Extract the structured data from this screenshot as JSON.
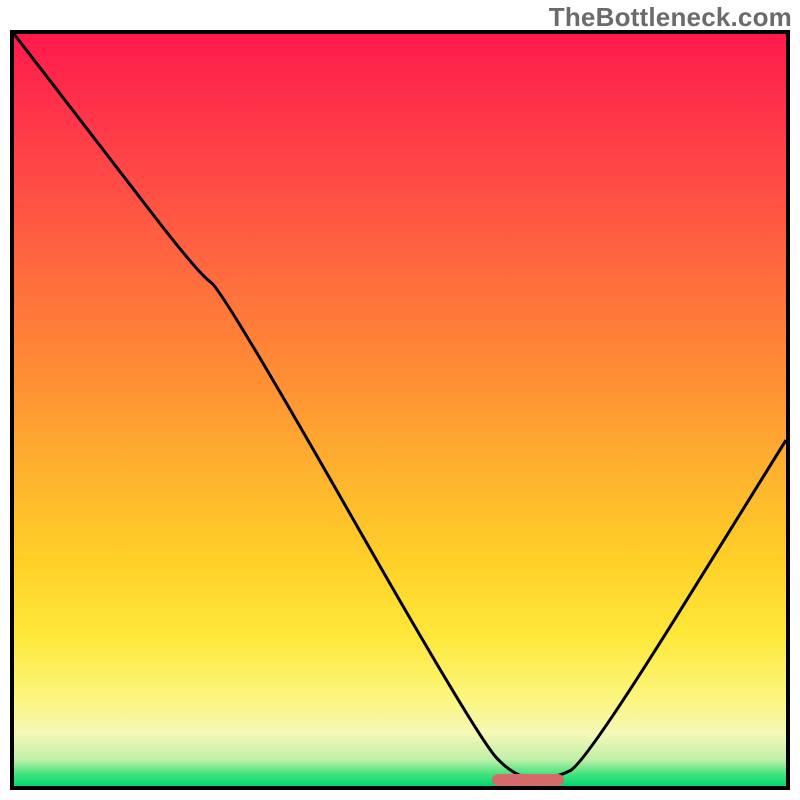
{
  "watermark": "TheBottleneck.com",
  "colors": {
    "watermark": "#6b6b6b",
    "curve": "#000000",
    "marker": "#d46a6a",
    "border": "#000000"
  },
  "marker": {
    "x_start_pct": 61.9,
    "x_end_pct": 71.3,
    "y_pct": 99.2
  },
  "chart_data": {
    "type": "line",
    "title": "",
    "xlabel": "",
    "ylabel": "",
    "xlim": [
      0,
      100
    ],
    "ylim": [
      0,
      100
    ],
    "x": [
      0.0,
      12.0,
      24.0,
      27.0,
      60.0,
      65.0,
      70.0,
      74.0,
      100.0
    ],
    "values": [
      100.0,
      84.0,
      68.0,
      66.0,
      6.5,
      1.0,
      1.0,
      3.0,
      46.0
    ],
    "notes": "V-shaped bottleneck curve. Values are percentage heights read off the unlabeled plot; x is position across width. Minimum (optimal zone) ≈ x 62–71 near y≈1. Slight elbow around x≈27."
  }
}
